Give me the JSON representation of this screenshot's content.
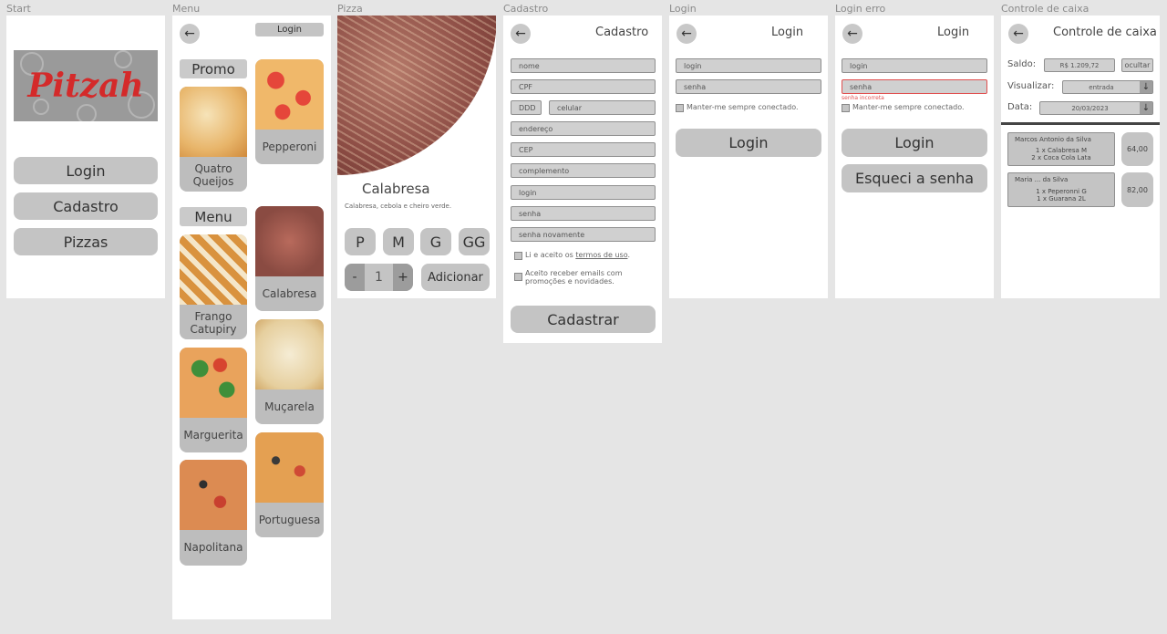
{
  "frames": {
    "start": "Start",
    "menu": "Menu",
    "pizza": "Pizza",
    "cadastro": "Cadastro",
    "login": "Login",
    "login_erro": "Login erro",
    "caixa": "Controle de caixa"
  },
  "start": {
    "logo": "Pitzah",
    "buttons": [
      "Login",
      "Cadastro",
      "Pizzas"
    ]
  },
  "menu": {
    "login_button": "Login",
    "promo_title": "Promo",
    "menu_title": "Menu",
    "pizzas": {
      "quatro_queijos": "Quatro\nQueijos",
      "pepperoni": "Pepperoni",
      "frango": "Frango\nCatupiry",
      "calabresa": "Calabresa",
      "mucarela": "Muçarela",
      "marguerita": "Marguerita",
      "portuguesa": "Portuguesa",
      "napolitana": "Napolitana"
    }
  },
  "pizza": {
    "name": "Calabresa",
    "description": "Calabresa, cebola e cheiro verde.",
    "sizes": [
      "P",
      "M",
      "G",
      "GG"
    ],
    "minus": "-",
    "quantity": "1",
    "plus": "+",
    "add_button": "Adicionar"
  },
  "cadastro": {
    "title": "Cadastro",
    "fields": {
      "nome": "nome",
      "cpf": "CPF",
      "ddd": "DDD",
      "celular": "celular",
      "endereco": "endereço",
      "cep": "CEP",
      "complemento": "complemento",
      "login": "login",
      "senha": "senha",
      "senha_novamente": "senha novamente"
    },
    "terms_prefix": "Li e aceito os ",
    "terms_link": "termos de uso",
    "terms_suffix": ".",
    "emails_line1": "Aceito receber emails com",
    "emails_line2": "promoções e novidades.",
    "submit": "Cadastrar"
  },
  "login": {
    "title": "Login",
    "login_placeholder": "login",
    "senha_placeholder": "senha",
    "remember": "Manter-me sempre conectado.",
    "submit": "Login"
  },
  "login_erro": {
    "title": "Login",
    "login_placeholder": "login",
    "senha_placeholder": "senha",
    "error_msg": "senha incorreta",
    "remember": "Manter-me sempre conectado.",
    "submit": "Login",
    "forgot": "Esqueci a senha",
    "error_color": "#e05050"
  },
  "caixa": {
    "title": "Controle de caixa",
    "saldo_label": "Saldo:",
    "saldo_value": "R$ 1.209,72",
    "ocultar": "ocultar",
    "visualizar_label": "Visualizar:",
    "visualizar_value": "entrada",
    "data_label": "Data:",
    "data_value": "20/03/2023",
    "orders": [
      {
        "name": "Marcos Antonio da Silva",
        "items": [
          "1 x Calabresa M",
          "2 x Coca Cola Lata"
        ],
        "price": "64,00"
      },
      {
        "name": "Maria ... da Silva",
        "items": [
          "1 x Peperonni G",
          "1 x Guarana 2L"
        ],
        "price": "82,00"
      }
    ]
  },
  "colors": {
    "background": "#e5e5e5",
    "frame": "#ffffff",
    "button": "#c4c4c4",
    "logo_red": "#d42a2a"
  }
}
